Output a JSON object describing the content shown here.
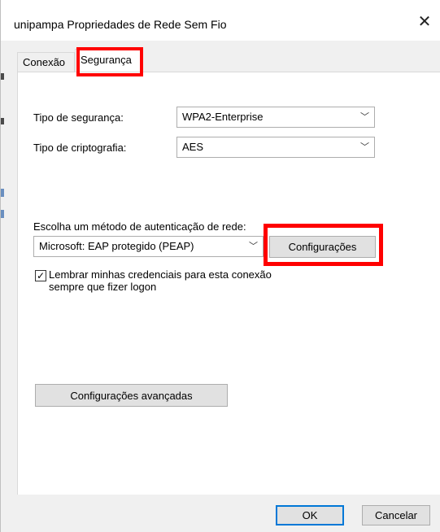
{
  "window": {
    "title": "unipampa Propriedades de Rede Sem Fio",
    "close_symbol": "✕"
  },
  "tabs": [
    {
      "label": "Conexão",
      "active": false
    },
    {
      "label": "Segurança",
      "active": true
    }
  ],
  "security": {
    "type_label": "Tipo de segurança:",
    "type_value": "WPA2-Enterprise",
    "encryption_label": "Tipo de criptografia:",
    "encryption_value": "AES"
  },
  "auth": {
    "method_label": "Escolha um método de autenticação de rede:",
    "method_value": "Microsoft: EAP protegido (PEAP)",
    "settings_button": "Configurações"
  },
  "remember": {
    "checked": true,
    "check_symbol": "✓",
    "label_line1": "Lembrar minhas credenciais para esta conexão",
    "label_line2": "sempre que fizer logon"
  },
  "advanced_button": "Configurações avançadas",
  "footer": {
    "ok_label": "OK",
    "cancel_label": "Cancelar"
  },
  "icons": {
    "chevron": "﹀",
    "chevron_name": "chevron-down-icon",
    "close_name": "close-icon"
  },
  "colors": {
    "highlight": "#ff0000",
    "accent": "#0078d7"
  }
}
